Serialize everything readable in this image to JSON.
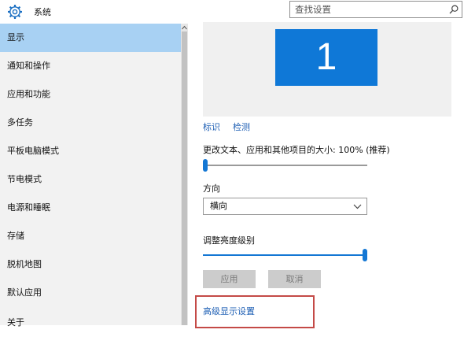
{
  "header": {
    "title": "系统",
    "search_placeholder": "查找设置"
  },
  "sidebar": {
    "items": [
      {
        "label": "显示",
        "active": true
      },
      {
        "label": "通知和操作"
      },
      {
        "label": "应用和功能"
      },
      {
        "label": "多任务"
      },
      {
        "label": "平板电脑模式"
      },
      {
        "label": "节电模式"
      },
      {
        "label": "电源和睡眠"
      },
      {
        "label": "存储"
      },
      {
        "label": "脱机地图"
      },
      {
        "label": "默认应用"
      },
      {
        "label": "关于"
      }
    ]
  },
  "main": {
    "monitor_number": "1",
    "identify_link": "标识",
    "detect_link": "检测",
    "scale_label": "更改文本、应用和其他项目的大小: 100% (推荐)",
    "scale_value_fraction": 0.0,
    "orientation_label": "方向",
    "orientation_value": "横向",
    "brightness_label": "调整亮度级别",
    "brightness_value_fraction": 1.0,
    "apply_button": "应用",
    "cancel_button": "取消",
    "advanced_link": "高级显示设置"
  },
  "colors": {
    "accent": "#1477d4",
    "sidebar_active": "#a8d1f3",
    "highlight": "#c44a47"
  }
}
